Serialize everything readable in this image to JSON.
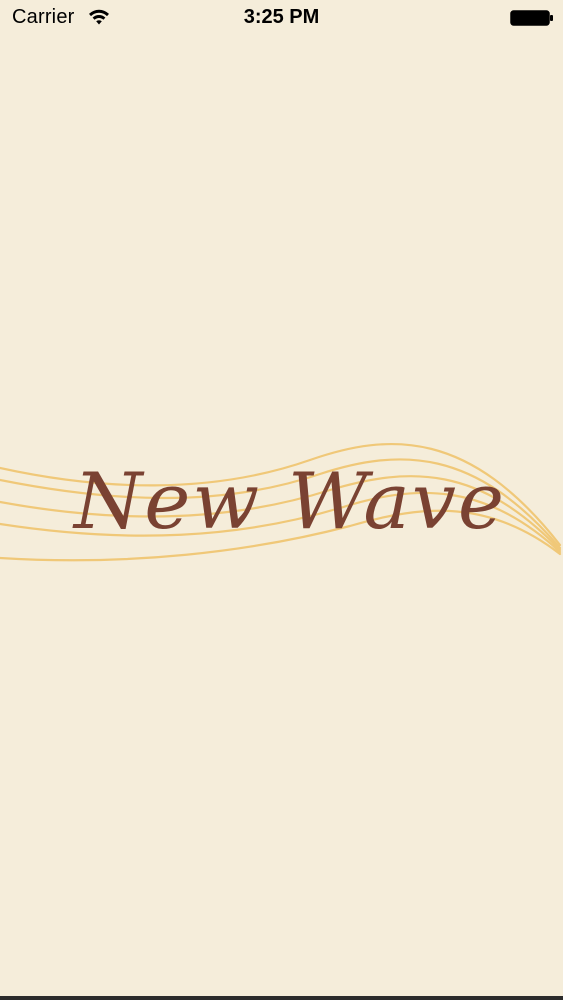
{
  "status_bar": {
    "carrier": "Carrier",
    "time": "3:25 PM",
    "wifi_icon": "wifi-icon",
    "battery_icon": "battery-icon"
  },
  "splash": {
    "logo_text": "New Wave",
    "logo_color": "#7a4232",
    "wave_color": "#f0c878",
    "background_color": "#f5edda"
  }
}
